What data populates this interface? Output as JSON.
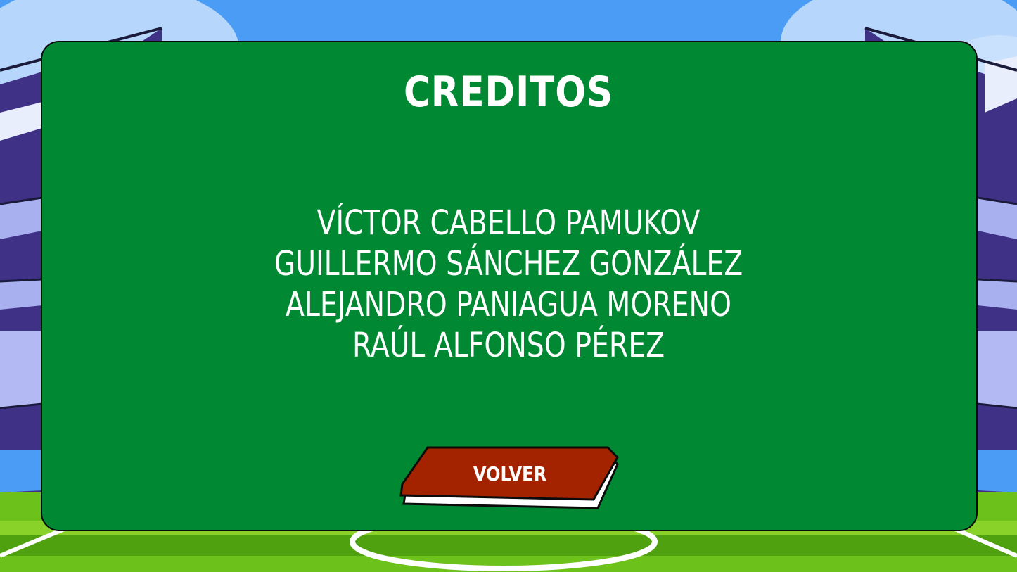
{
  "title": "CREDITOS",
  "credits": [
    "VÍCTOR CABELLO PAMUKOV",
    "GUILLERMO SÁNCHEZ GONZÁLEZ",
    "ALEJANDRO PANIAGUA MORENO",
    "RAÚL ALFONSO PÉREZ"
  ],
  "back_button_label": "VOLVER",
  "colors": {
    "panel": "#008833",
    "button": "#a32200",
    "sky": "#4a9cf5",
    "grass": "#6cc21a",
    "stands": "#4a3a94"
  },
  "icons": {
    "background": "stadium-background"
  }
}
